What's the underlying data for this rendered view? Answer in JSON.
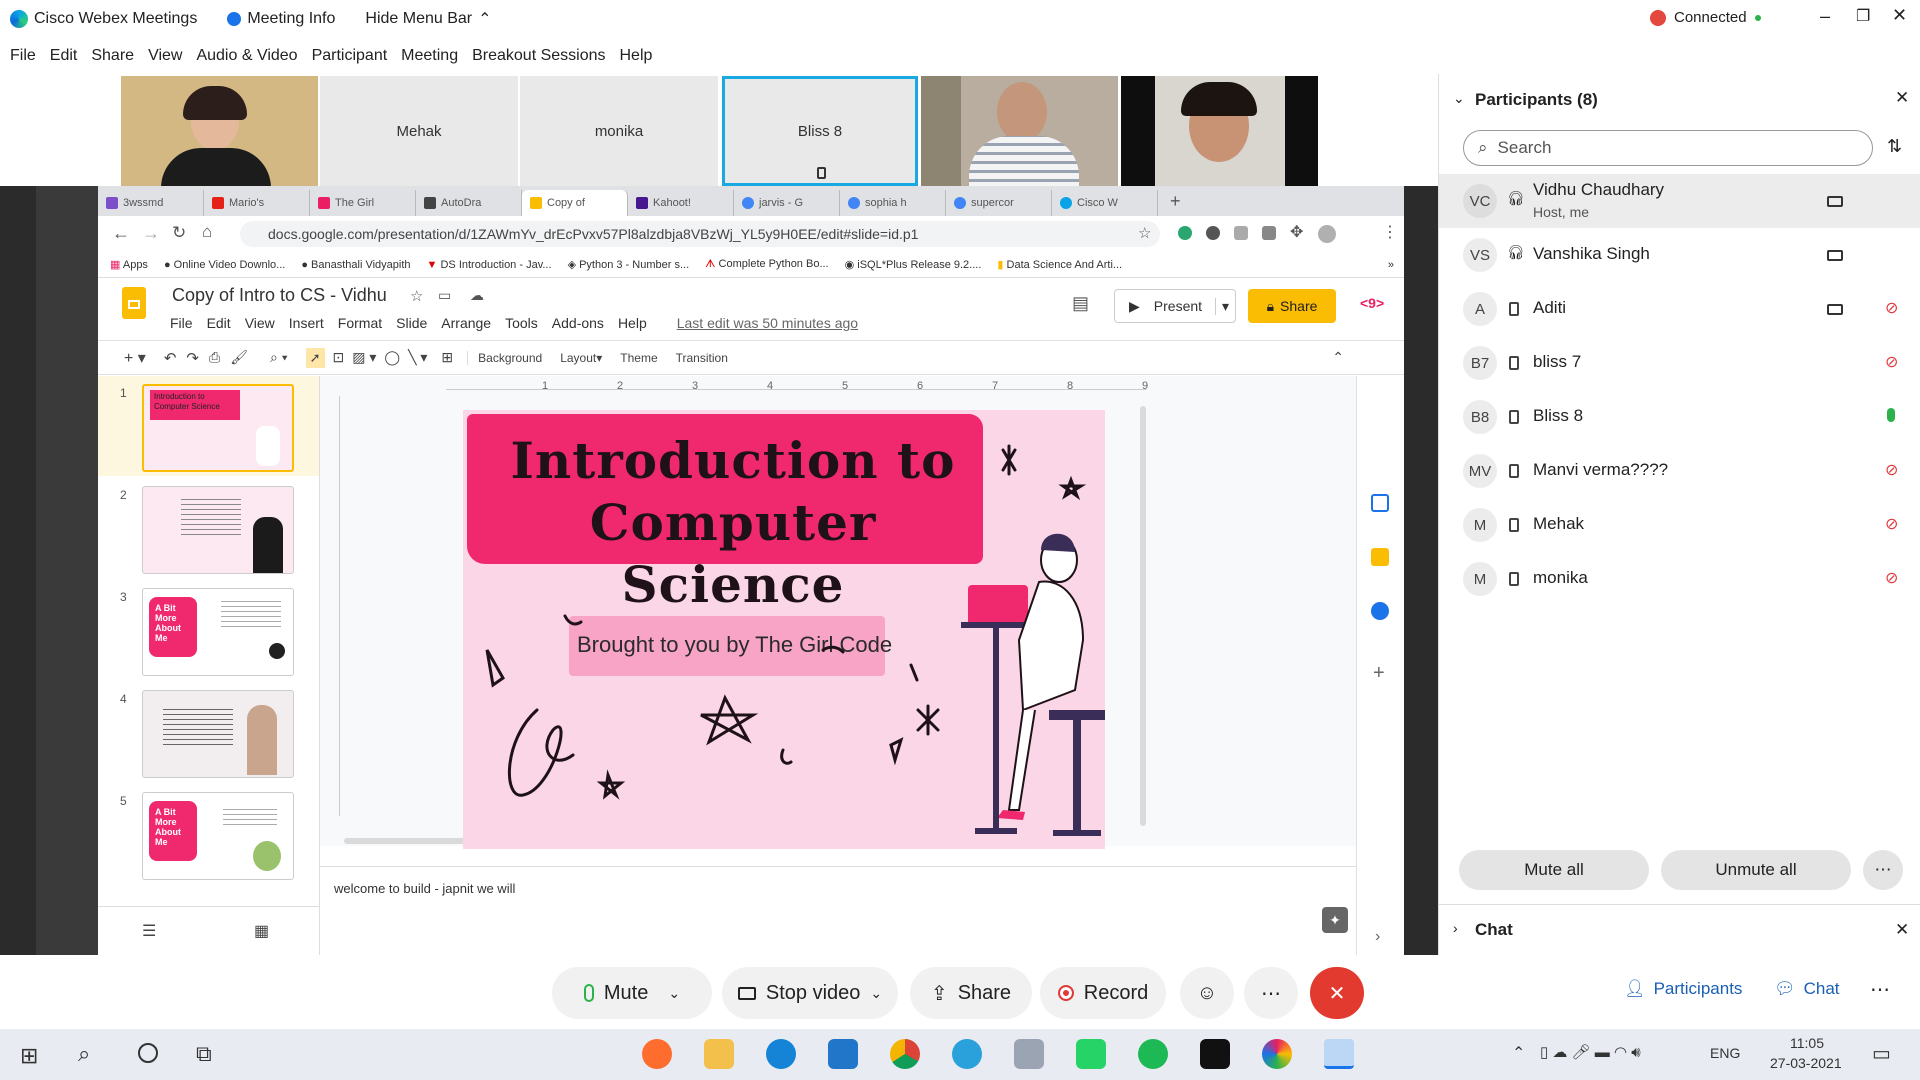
{
  "titlebar": {
    "app_name": "Cisco Webex Meetings",
    "meeting_info": "Meeting Info",
    "hide_menu": "Hide Menu Bar",
    "connection": "Connected"
  },
  "menubar": [
    "File",
    "Edit",
    "Share",
    "View",
    "Audio & Video",
    "Participant",
    "Meeting",
    "Breakout Sessions",
    "Help"
  ],
  "video_strip": [
    {
      "label": "",
      "type": "camera"
    },
    {
      "label": "Mehak",
      "type": "name"
    },
    {
      "label": "monika",
      "type": "name"
    },
    {
      "label": "Bliss 8",
      "type": "name-active"
    },
    {
      "label": "",
      "type": "camera"
    },
    {
      "label": "",
      "type": "camera"
    }
  ],
  "browser": {
    "tabs": [
      "3wssmd",
      "Mario's",
      "The Girl",
      "AutoDra",
      "Copy of",
      "Kahoot!",
      "jarvis - G",
      "sophia h",
      "supercor",
      "Cisco W"
    ],
    "url": "docs.google.com/presentation/d/1ZAWmYv_drEcPvxv57Pl8alzdbja8VBzWj_YL5y9H0EE/edit#slide=id.p1",
    "bookmarks": [
      "Apps",
      "Online Video Downlo...",
      "Banasthali Vidyapith",
      "DS Introduction - Jav...",
      "Python 3 - Number s...",
      "Complete Python Bo...",
      "iSQL*Plus Release 9.2....",
      "Data Science And Arti..."
    ]
  },
  "slides": {
    "doc_title": "Copy of Intro to CS - Vidhu",
    "menu": [
      "File",
      "Edit",
      "View",
      "Insert",
      "Format",
      "Slide",
      "Arrange",
      "Tools",
      "Add-ons",
      "Help"
    ],
    "last_edit": "Last edit was 50 minutes ago",
    "present_label": "Present",
    "share_label": "Share",
    "toolbar": [
      "Background",
      "Layout",
      "Theme",
      "Transition"
    ],
    "thumb_numbers": [
      "1",
      "2",
      "3",
      "4",
      "5"
    ],
    "slide_title_line1": "Introduction to",
    "slide_title_line2": "Computer Science",
    "slide_subtitle": "Brought to you by The Girl Code",
    "notes": "welcome to build - japnit we will",
    "thumb_texts": {
      "t1_title": "Introduction to Computer Science",
      "t3_label": "A Bit More About Me",
      "t5_label": "A Bit More About Me"
    },
    "ruler_labels": [
      "1",
      "2",
      "3",
      "4",
      "5",
      "6",
      "7",
      "8",
      "9"
    ]
  },
  "participants": {
    "header": "Participants (8)",
    "search_placeholder": "Search",
    "list": [
      {
        "initials": "VC",
        "name": "Vidhu Chaudhary",
        "sub": "Host, me",
        "mic": "on",
        "cam": true
      },
      {
        "initials": "VS",
        "name": "Vanshika Singh",
        "sub": "",
        "mic": "on",
        "cam": true
      },
      {
        "initials": "A",
        "name": "Aditi",
        "sub": "",
        "mic": "muted",
        "cam": true
      },
      {
        "initials": "B7",
        "name": "bliss 7",
        "sub": "",
        "mic": "muted",
        "cam": false
      },
      {
        "initials": "B8",
        "name": "Bliss 8",
        "sub": "",
        "mic": "active",
        "cam": false
      },
      {
        "initials": "MV",
        "name": "Manvi verma????",
        "sub": "",
        "mic": "muted",
        "cam": false
      },
      {
        "initials": "M",
        "name": "Mehak",
        "sub": "",
        "mic": "muted",
        "cam": false
      },
      {
        "initials": "M",
        "name": "monika",
        "sub": "",
        "mic": "muted",
        "cam": false
      }
    ],
    "mute_all": "Mute all",
    "unmute_all": "Unmute all",
    "chat_header": "Chat"
  },
  "controls": {
    "mute": "Mute",
    "stop_video": "Stop video",
    "share": "Share",
    "record": "Record",
    "participants": "Participants",
    "chat": "Chat"
  },
  "taskbar": {
    "time": "11:05",
    "date": "27-03-2021",
    "lang": "ENG"
  },
  "colors": {
    "accent": "#e91e63",
    "end_red": "#e23a2f",
    "yellow": "#fbbc04"
  }
}
